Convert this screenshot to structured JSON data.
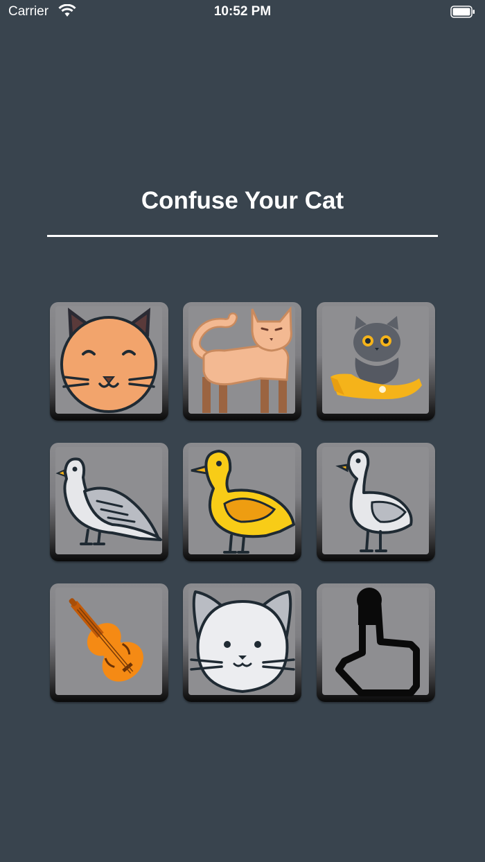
{
  "status_bar": {
    "carrier": "Carrier",
    "time": "10:52 PM"
  },
  "title": "Confuse Your Cat",
  "buttons": [
    {
      "icon": "smiling-cat-face-icon"
    },
    {
      "icon": "standing-cat-icon"
    },
    {
      "icon": "cat-in-hand-icon"
    },
    {
      "icon": "pigeon-icon"
    },
    {
      "icon": "duck-icon"
    },
    {
      "icon": "goose-icon"
    },
    {
      "icon": "violin-icon"
    },
    {
      "icon": "white-cat-face-icon"
    },
    {
      "icon": "tap-hand-icon"
    }
  ],
  "colors": {
    "background": "#39444e",
    "tile_face": "#8e8e91",
    "text": "#ffffff"
  }
}
